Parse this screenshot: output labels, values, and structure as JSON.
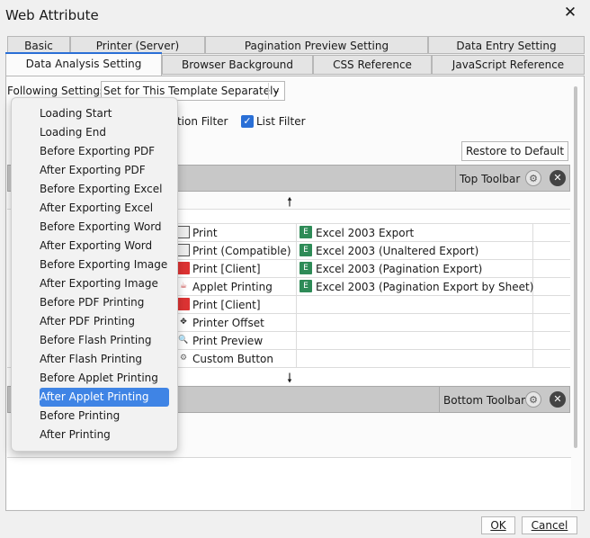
{
  "window": {
    "title": "Web Attribute",
    "close_glyph": "✕"
  },
  "tabs_top": [
    "Basic",
    "Printer (Server)",
    "Pagination Preview Setting",
    "Data Entry Setting"
  ],
  "tabs_bottom": [
    "Data Analysis Setting",
    "Browser Background",
    "CSS Reference",
    "JavaScript Reference"
  ],
  "settings": {
    "label": "Following Settings:",
    "combo_value": "Set for This Template Separately",
    "combo_arrow": "⌄"
  },
  "filters": {
    "condition_filter_partial": "dition Filter",
    "list_filter": "List Filter",
    "check_glyph": "✓"
  },
  "buttons": {
    "restore": "Restore to Default",
    "ok": "OK",
    "cancel": "Cancel"
  },
  "top_toolbar": {
    "label": "Top Toolbar"
  },
  "bottom_toolbar": {
    "label": "Bottom Toolbar"
  },
  "arrows": {
    "up": "🠕",
    "down": "🠗"
  },
  "col_print": [
    "Print",
    "Print (Compatible)",
    "Print [Client]",
    "Applet Printing",
    "Print [Client]",
    "Printer Offset",
    "Print Preview",
    "Custom Button"
  ],
  "col_excel": [
    "Excel 2003 Export",
    "Excel 2003 (Unaltered Export)",
    "Excel 2003 (Pagination Export)",
    "Excel 2003 (Pagination Export by Sheet)"
  ],
  "dropdown_items": [
    "Loading Start",
    "Loading End",
    "Before Exporting PDF",
    "After Exporting PDF",
    "Before Exporting Excel",
    "After Exporting Excel",
    "Before Exporting Word",
    "After Exporting Word",
    "Before Exporting Image",
    "After Exporting Image",
    "Before PDF Printing",
    "After PDF Printing",
    "Before Flash Printing",
    "After Flash Printing",
    "Before Applet Printing",
    "After Applet Printing",
    "Before Printing",
    "After Printing"
  ],
  "dropdown_selected": "After Applet Printing",
  "colors": {
    "accent": "#2a6fd6",
    "selected_bg": "#3f84e5",
    "toolbar_bg": "#c8c8c8",
    "excel_icon": "#2e8b57",
    "pdf_icon": "#dd3333"
  },
  "icons": {
    "settings": "gear-icon",
    "remove": "close-circle-icon",
    "print": "printer-icon",
    "excel": "excel-icon",
    "pdf": "pdf-icon"
  }
}
